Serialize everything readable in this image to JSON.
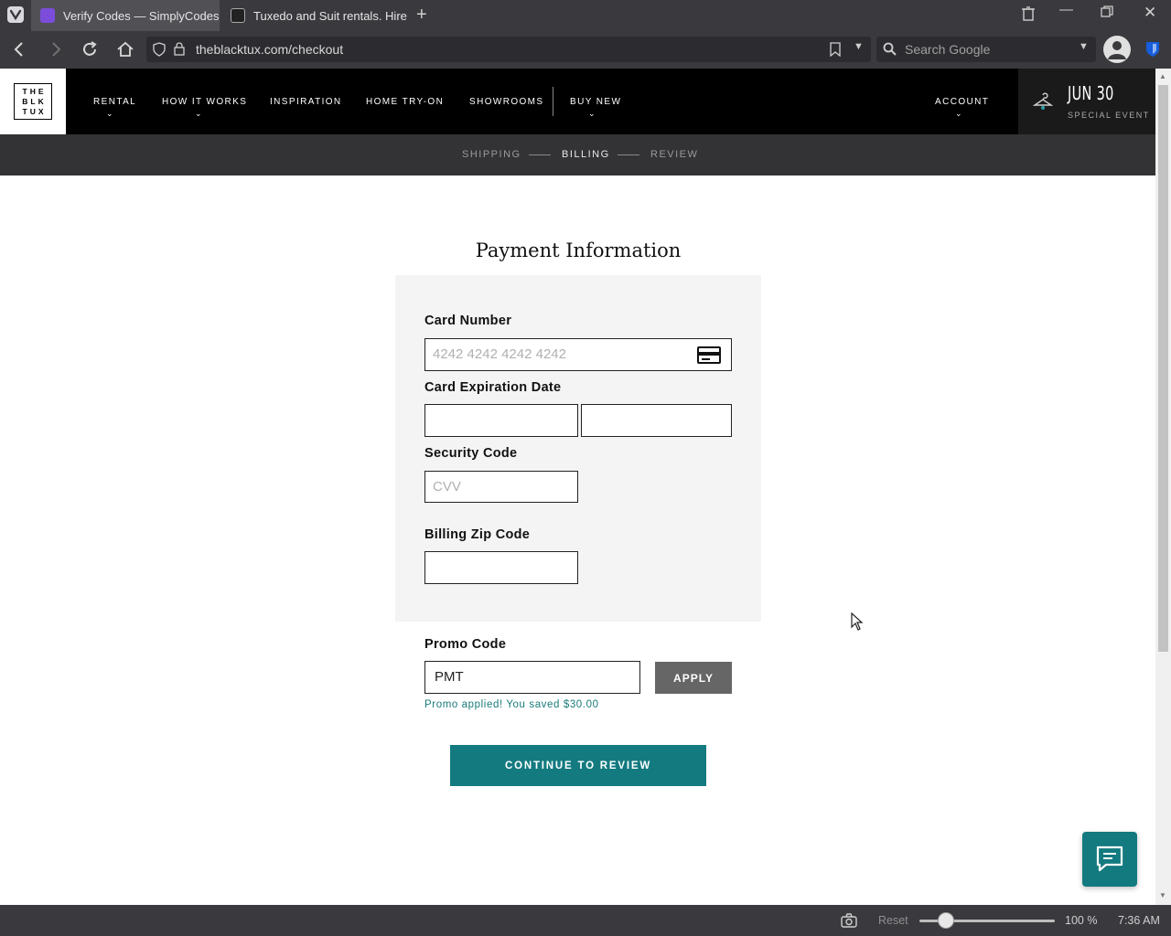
{
  "browser": {
    "tabs": [
      {
        "title": "Verify Codes — SimplyCodes",
        "active": true
      },
      {
        "title": "Tuxedo and Suit rentals. Hire",
        "active": false
      }
    ],
    "url": "theblacktux.com/checkout",
    "search_placeholder": "Search Google"
  },
  "site": {
    "logo_lines": [
      "THE",
      "BLK",
      "TUX"
    ],
    "nav": {
      "rental": "RENTAL",
      "how_it_works": "HOW IT WORKS",
      "inspiration": "INSPIRATION",
      "home_try_on": "HOME TRY-ON",
      "showrooms": "SHOWROOMS",
      "buy_new": "BUY NEW",
      "account": "ACCOUNT"
    },
    "event": {
      "date": "JUN 30",
      "label": "SPECIAL EVENT"
    }
  },
  "steps": {
    "shipping": "SHIPPING",
    "billing": "BILLING",
    "review": "REVIEW",
    "current": "BILLING"
  },
  "payment": {
    "title": "Payment Information",
    "card_number_label": "Card Number",
    "card_number_placeholder": "4242 4242 4242 4242",
    "expiration_label": "Card Expiration Date",
    "security_label": "Security Code",
    "security_placeholder": "CVV",
    "zip_label": "Billing Zip Code"
  },
  "promo": {
    "label": "Promo Code",
    "value": "PMT",
    "apply_label": "APPLY",
    "message": "Promo applied! You saved $30.00"
  },
  "continue_label": "CONTINUE TO REVIEW",
  "statusbar": {
    "reset": "Reset",
    "zoom": "100 %",
    "time": "7:36 AM",
    "zoom_level": 0.2
  },
  "colors": {
    "accent": "#137a80",
    "header_bg": "#000000",
    "steps_bg": "#333335",
    "panel_bg": "#f4f4f4"
  }
}
